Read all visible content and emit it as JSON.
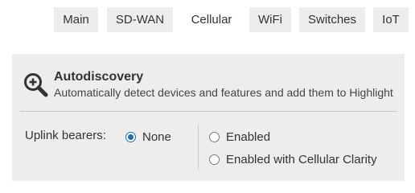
{
  "tabs": [
    {
      "label": "Main",
      "active": false
    },
    {
      "label": "SD-WAN",
      "active": false
    },
    {
      "label": "Cellular",
      "active": true
    },
    {
      "label": "WiFi",
      "active": false
    },
    {
      "label": "Switches",
      "active": false
    },
    {
      "label": "IoT",
      "active": false
    }
  ],
  "panel": {
    "icon": "search-plus-icon",
    "title": "Autodiscovery",
    "subtitle": "Automatically detect devices and features and add them to Highlight"
  },
  "uplink": {
    "label": "Uplink bearers:",
    "selected": "None",
    "options": [
      {
        "label": "None",
        "checked": true
      },
      {
        "label": "Enabled",
        "checked": false
      },
      {
        "label": "Enabled with Cellular Clarity",
        "checked": false
      }
    ]
  },
  "colors": {
    "accent": "#1b6fb5",
    "panel_bg": "#ededed",
    "tab_bg": "#ededed",
    "text": "#333333"
  }
}
